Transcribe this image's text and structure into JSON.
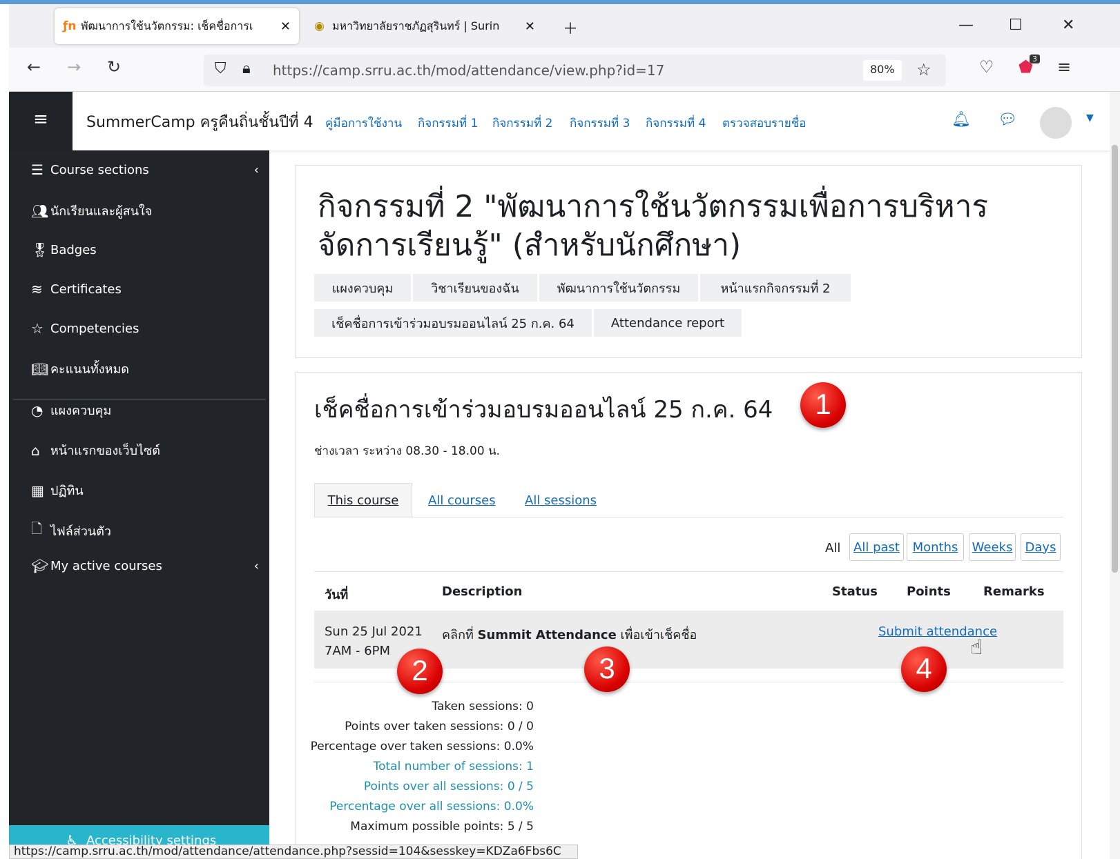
{
  "browser": {
    "tabs": [
      {
        "title": "พัฒนาการใช้นวัตกรรม: เช็คชื่อการเ",
        "favicon": "moodle-icon"
      },
      {
        "title": "มหาวิทยาลัยราชภัฏสุรินทร์ | Surin",
        "favicon": "university-seal-icon"
      }
    ],
    "url": "https://camp.srru.ac.th/mod/attendance/view.php?id=17",
    "zoom": "80%",
    "pocket_badge": "3",
    "status_url": "https://camp.srru.ac.th/mod/attendance/attendance.php?sessid=104&sesskey=KDZa6Fbs6C"
  },
  "header": {
    "site_name": "SummerCamp ครูคืนถิ่นชั้นปีที่ 4",
    "nav": [
      "คู่มือการใช้งาน",
      "กิจกรรมที่ 1",
      "กิจกรรมที่ 2",
      "กิจกรรมที่ 3",
      "กิจกรรมที่ 4",
      "ตรวจสอบรายชื่อ"
    ]
  },
  "sidebar": {
    "items": [
      {
        "label": "Course sections"
      },
      {
        "label": "นักเรียนและผู้สนใจ"
      },
      {
        "label": "Badges"
      },
      {
        "label": "Certificates"
      },
      {
        "label": "Competencies"
      },
      {
        "label": "คะแนนทั้งหมด"
      },
      {
        "label": "แผงควบคุม"
      },
      {
        "label": "หน้าแรกของเว็บไซต์"
      },
      {
        "label": "ปฏิทิน"
      },
      {
        "label": "ไฟล์ส่วนตัว"
      },
      {
        "label": "My active courses"
      }
    ],
    "accessibility": "Accessibility settings"
  },
  "page": {
    "title": "กิจกรรมที่ 2 \"พัฒนาการใช้นวัตกรรมเพื่อการบริหารจัดการเรียนรู้\" (สำหรับนักศึกษา)",
    "breadcrumbs": [
      "แผงควบคุม",
      "วิชาเรียนของฉัน",
      "พัฒนาการใช้นวัตกรรม",
      "หน้าแรกกิจกรรมที่ 2",
      "เช็คชื่อการเข้าร่วมอบรมออนไลน์ 25 ก.ค. 64",
      "Attendance report"
    ]
  },
  "activity": {
    "title": "เช็คชื่อการเข้าร่วมอบรมออนไลน์ 25 ก.ค. 64",
    "subtitle": "ช่างเวลา ระหว่าง 08.30 - 18.00 น.",
    "tabs": [
      "This course",
      "All courses",
      "All sessions"
    ],
    "filter_all": "All",
    "filters": [
      "All past",
      "Months",
      "Weeks",
      "Days"
    ],
    "columns": {
      "date": "วันที่",
      "description": "Description",
      "status": "Status",
      "points": "Points",
      "remarks": "Remarks"
    },
    "row": {
      "date": "Sun 25 Jul 2021",
      "time": "7AM - 6PM",
      "desc_prefix": "คลิกที่",
      "desc_bold": "Summit Attendance",
      "desc_suffix": "เพื่อเข้าเช็คชื่อ",
      "action": "Submit attendance"
    },
    "summary": [
      {
        "label": "Taken sessions:",
        "value": "0"
      },
      {
        "label": "Points over taken sessions:",
        "value": "0 / 0"
      },
      {
        "label": "Percentage over taken sessions:",
        "value": "0.0%"
      },
      {
        "label": "Total number of sessions:",
        "value": "1"
      },
      {
        "label": "Points over all sessions:",
        "value": "0 / 5"
      },
      {
        "label": "Percentage over all sessions:",
        "value": "0.0%"
      },
      {
        "label": "Maximum possible points:",
        "value": "5 / 5"
      }
    ]
  },
  "annotations": [
    "1",
    "2",
    "3",
    "4"
  ]
}
